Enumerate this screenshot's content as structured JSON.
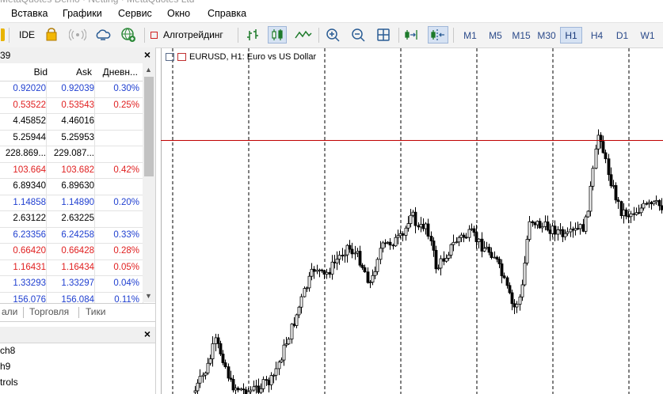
{
  "menu": [
    "Вставка",
    "Графики",
    "Сервис",
    "Окно",
    "Справка"
  ],
  "toolbar": {
    "ide_label": "IDE",
    "algo_label": "Алготрейдинг",
    "timeframes": [
      "M1",
      "M5",
      "M15",
      "M30",
      "H1",
      "H4",
      "D1",
      "W1"
    ],
    "active_timeframe": "H1"
  },
  "market_watch": {
    "header_partial": "39",
    "columns": {
      "bid": "Bid",
      "ask": "Ask",
      "change": "Дневн..."
    },
    "rows": [
      {
        "bid": "0.92020",
        "ask": "0.92039",
        "change": "0.30%",
        "color": "#1f3fd0"
      },
      {
        "bid": "0.53522",
        "ask": "0.53543",
        "change": "0.25%",
        "color": "#e02020"
      },
      {
        "bid": "4.45852",
        "ask": "4.46016",
        "change": "",
        "color": "#000000"
      },
      {
        "bid": "5.25944",
        "ask": "5.25953",
        "change": "",
        "color": "#000000"
      },
      {
        "bid": "228.869...",
        "ask": "229.087...",
        "change": "",
        "color": "#000000"
      },
      {
        "bid": "103.664",
        "ask": "103.682",
        "change": "0.42%",
        "color": "#e02020"
      },
      {
        "bid": "6.89340",
        "ask": "6.89630",
        "change": "",
        "color": "#000000"
      },
      {
        "bid": "1.14858",
        "ask": "1.14890",
        "change": "0.20%",
        "color": "#1f3fd0"
      },
      {
        "bid": "2.63122",
        "ask": "2.63225",
        "change": "",
        "color": "#000000"
      },
      {
        "bid": "6.23356",
        "ask": "6.24258",
        "change": "0.33%",
        "color": "#1f3fd0"
      },
      {
        "bid": "0.66420",
        "ask": "0.66428",
        "change": "0.28%",
        "color": "#e02020"
      },
      {
        "bid": "1.16431",
        "ask": "1.16434",
        "change": "0.05%",
        "color": "#e02020"
      },
      {
        "bid": "1.33293",
        "ask": "1.33297",
        "change": "0.04%",
        "color": "#1f3fd0"
      },
      {
        "bid": "156.076",
        "ask": "156.084",
        "change": "0.11%",
        "color": "#1f3fd0"
      }
    ],
    "tabs": [
      "али",
      "Торговля",
      "Тики"
    ]
  },
  "navigator": {
    "items": [
      "ch8",
      "h9",
      "trols"
    ]
  },
  "chart": {
    "title": "EURUSD, H1:  Euro vs US Dollar",
    "grid_color": "#000000",
    "price_line_color": "#c00000",
    "candle_color": "#000000"
  }
}
